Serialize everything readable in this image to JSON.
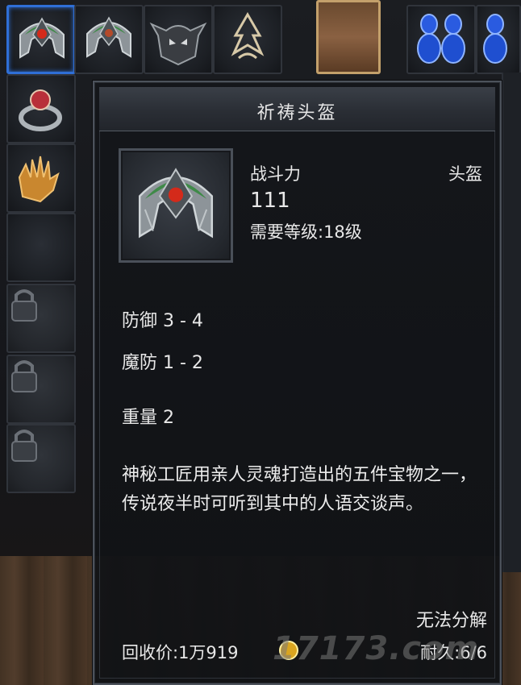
{
  "tooltip": {
    "title": "祈祷头盔",
    "combat_power_label": "战斗力",
    "combat_power_value": "111",
    "item_type": "头盔",
    "level_requirement": "需要等级:18级",
    "stats": {
      "defense": "防御 3 - 4",
      "magic_defense": "魔防 1 - 2",
      "weight": "重量 2"
    },
    "description": "神秘工匠用亲人灵魂打造出的五件宝物之一，传说夜半时可听到其中的人语交谈声。",
    "cannot_dismantle": "无法分解",
    "recycle_price": "回收价:1万919",
    "durability": "耐久:6/6"
  },
  "watermark": "17173.com",
  "inventory": {
    "selected_item": "helmet",
    "locked_slots": 3
  },
  "colors": {
    "selection_border": "#2f6fd6",
    "gem_red": "#d42a1a",
    "helmet_green": "#3f8a48"
  }
}
